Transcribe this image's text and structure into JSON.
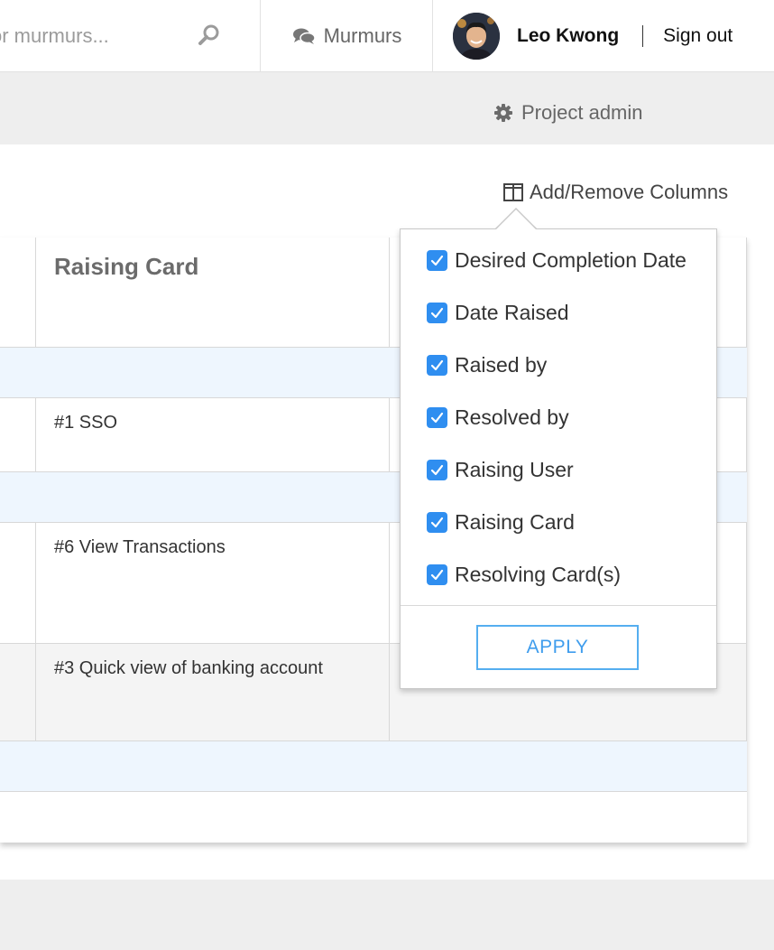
{
  "topbar": {
    "search_placeholder": "or murmurs...",
    "murmurs_label": "Murmurs",
    "user_name": "Leo Kwong",
    "sign_out_label": "Sign out"
  },
  "subheader": {
    "project_admin_label": "Project admin"
  },
  "toolbar": {
    "columns_label": "Add/Remove Columns"
  },
  "table": {
    "header": "Raising Card",
    "rows": [
      {
        "card": ""
      },
      {
        "card": "#1 SSO"
      },
      {
        "card": ""
      },
      {
        "card": "#6 View Transactions"
      },
      {
        "card": "#3 Quick view of banking account"
      },
      {
        "card": ""
      }
    ]
  },
  "columns_menu": {
    "options": [
      {
        "label": "Desired Completion Date",
        "checked": true
      },
      {
        "label": "Date Raised",
        "checked": true
      },
      {
        "label": "Raised by",
        "checked": true
      },
      {
        "label": "Resolved by",
        "checked": true
      },
      {
        "label": "Raising User",
        "checked": true
      },
      {
        "label": "Raising Card",
        "checked": true
      },
      {
        "label": "Resolving Card(s)",
        "checked": true
      }
    ],
    "apply_label": "APPLY"
  },
  "colors": {
    "accent": "#2f8ef0",
    "apply_border": "#55aef0",
    "row_highlight": "#eef6fe",
    "band": "#eeeeee"
  },
  "icons": [
    "search-icon",
    "chat-icon",
    "gear-icon",
    "columns-icon",
    "checkmark-icon"
  ]
}
